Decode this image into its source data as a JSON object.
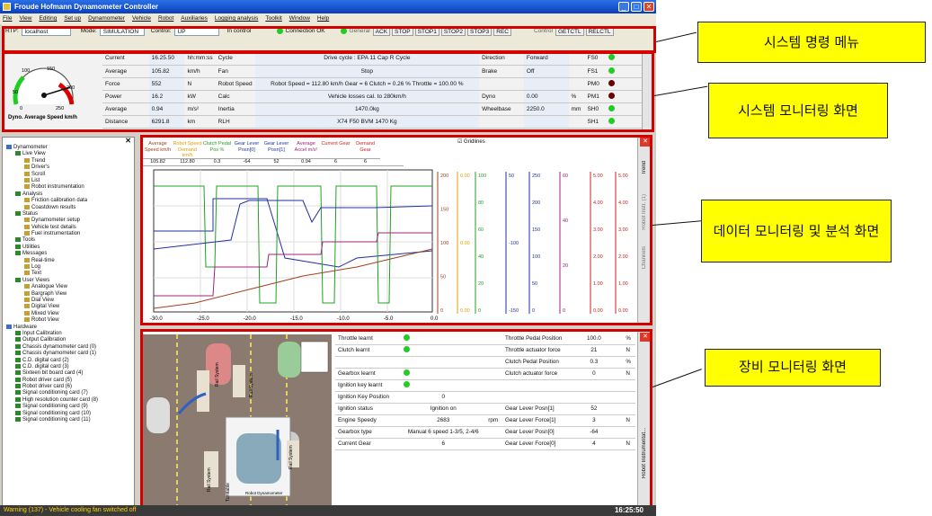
{
  "window": {
    "title": "Froude Hofmann Dynamometer Controller"
  },
  "menu": [
    "File",
    "View",
    "Editing",
    "Set up",
    "Dynamometer",
    "Vehicle",
    "Robot",
    "Auxiliaries",
    "Logging analysis",
    "Toolkit",
    "Window",
    "Help"
  ],
  "command_bar": {
    "rtp_label": "RTP:",
    "rtp_value": "localhost",
    "mode_label": "Mode:",
    "mode_value": "SIMULATION",
    "control_label": "Control:",
    "control_value": "UP",
    "in_control": "In control",
    "connection": "Connection OK",
    "general_label": "General",
    "general_buttons": [
      "ACK",
      "STOP",
      "STOP1",
      "STOP2",
      "STOP3",
      "REC"
    ],
    "control2_label": "Control",
    "control_buttons": [
      "GETCTL",
      "RELCTL"
    ]
  },
  "monitor": {
    "gauge_label": "Dyno. Average Speed km/h",
    "gauge_ticks": [
      "50",
      "100",
      "150",
      "200",
      "250",
      "0"
    ],
    "rows": [
      {
        "name": "Current",
        "value": "16.25.50",
        "unit": "hh:mm:ss",
        "c2": "Cycle",
        "c2v": "Drive cycle : EPA 11 Cap R Cycle",
        "c3": "Direction",
        "c3v": "Forward",
        "c4": "FS0"
      },
      {
        "name": "Average",
        "value": "105.82",
        "unit": "km/h",
        "c2": "Fan",
        "c2v": "Stop",
        "c3": "Brake",
        "c3v": "Off",
        "c4": "FS1"
      },
      {
        "name": "Force",
        "value": "552",
        "unit": "N",
        "c2": "Robot Speed",
        "c2v": "Robot Speed = 112.80 km/h Gear = 6 Clutch = 0.26 % Throttle = 100.00 %",
        "c3": "",
        "c3v": "",
        "c4": "PM0"
      },
      {
        "name": "Power",
        "value": "16.2",
        "unit": "kW",
        "c2": "Calc",
        "c2v": "Vehicle losses cal. to 280km/h",
        "c3": "Dyno",
        "c3v": "0.00",
        "c3u": "%",
        "c4": "PM1"
      },
      {
        "name": "Average",
        "value": "0.94",
        "unit": "m/s²",
        "c2": "Inertia",
        "c2v": "1470.0kg",
        "c3": "Wheelbase",
        "c3v": "2250.0",
        "c3u": "mm",
        "c4": "SH0"
      },
      {
        "name": "Distance",
        "value": "6291.8",
        "unit": "km",
        "c2": "RLH",
        "c2v": "X74 F50 BVM 1470 Kg",
        "c3": "",
        "c3v": "",
        "c4": "SH1"
      }
    ]
  },
  "tree": [
    {
      "label": "Dynamometer",
      "level": 0
    },
    {
      "label": "Live View",
      "level": 1
    },
    {
      "label": "Trend",
      "level": 2
    },
    {
      "label": "Driver's",
      "level": 2
    },
    {
      "label": "Scroll",
      "level": 2
    },
    {
      "label": "List",
      "level": 2
    },
    {
      "label": "Robot instrumentation",
      "level": 2
    },
    {
      "label": "Analysis",
      "level": 1
    },
    {
      "label": "Friction calibration data",
      "level": 2
    },
    {
      "label": "Coastdown results",
      "level": 2
    },
    {
      "label": "Status",
      "level": 1
    },
    {
      "label": "Dynamometer setup",
      "level": 2
    },
    {
      "label": "Vehicle test details",
      "level": 2
    },
    {
      "label": "Fuel instrumentation",
      "level": 2
    },
    {
      "label": "Tools",
      "level": 1
    },
    {
      "label": "Utilities",
      "level": 1
    },
    {
      "label": "Messages",
      "level": 1
    },
    {
      "label": "Real-time",
      "level": 2
    },
    {
      "label": "Log",
      "level": 2
    },
    {
      "label": "Text",
      "level": 2
    },
    {
      "label": "User Views",
      "level": 1
    },
    {
      "label": "Analogue View",
      "level": 2
    },
    {
      "label": "Bargraph View",
      "level": 2
    },
    {
      "label": "Dial View",
      "level": 2
    },
    {
      "label": "Digital View",
      "level": 2
    },
    {
      "label": "Mixed View",
      "level": 2
    },
    {
      "label": "Robot View",
      "level": 2
    },
    {
      "label": "Hardware",
      "level": 0
    },
    {
      "label": "Input Calibration",
      "level": 1
    },
    {
      "label": "Output Calibration",
      "level": 1
    },
    {
      "label": "Chassis dynamometer card (0)",
      "level": 1
    },
    {
      "label": "Chassis dynamometer card (1)",
      "level": 1
    },
    {
      "label": "C.D. digital card (2)",
      "level": 1
    },
    {
      "label": "C.D. digital card (3)",
      "level": 1
    },
    {
      "label": "Sixteen bit board card (4)",
      "level": 1
    },
    {
      "label": "Robot driver card (5)",
      "level": 1
    },
    {
      "label": "Robot driver card (6)",
      "level": 1
    },
    {
      "label": "Signal conditioning card (7)",
      "level": 1
    },
    {
      "label": "High resolution counter card (8)",
      "level": 1
    },
    {
      "label": "Signal conditioning card (9)",
      "level": 1
    },
    {
      "label": "Signal conditioning card (10)",
      "level": 1
    },
    {
      "label": "Signal conditioning card (11)",
      "level": 1
    }
  ],
  "graph": {
    "gridlines_label": "Gridlines",
    "legend": [
      {
        "name": "Average Speed km/h",
        "value": "105.82",
        "color": "#a04020"
      },
      {
        "name": "Robot Speed Demand km/h",
        "value": "112.80",
        "color": "#e0a000"
      },
      {
        "name": "Clutch Pedal Pos %",
        "value": "0.3",
        "color": "#20a020"
      },
      {
        "name": "Gear Lever Posn[0]",
        "value": "-64",
        "color": "#2030a0"
      },
      {
        "name": "Gear Lever Posn[1]",
        "value": "52",
        "color": "#2030a0"
      },
      {
        "name": "Average Accel m/s²",
        "value": "0.94",
        "color": "#a02080"
      },
      {
        "name": "Current Gear",
        "value": "6",
        "color": "#d02020"
      },
      {
        "name": "Demand Gear",
        "value": "6",
        "color": "#d02020"
      }
    ],
    "x_ticks": [
      "-30.0",
      "-25.0",
      "-20.0",
      "-15.0",
      "-10.0",
      "-5.0",
      "0.0"
    ],
    "axis1": [
      "200",
      "150",
      "100",
      "50",
      "0"
    ],
    "axis2": [
      "0.00",
      "0.00",
      "0.00"
    ],
    "axis3": [
      "100",
      "80",
      "60",
      "40",
      "20",
      "0"
    ],
    "axis4": [
      "50",
      "-100",
      "-150"
    ],
    "axis5": [
      "250",
      "200",
      "150",
      "100",
      "50",
      "0"
    ],
    "axis6": [
      "60",
      "40",
      "20",
      "0"
    ],
    "axis7": [
      "5.00",
      "4.00",
      "3.00",
      "2.00",
      "1.00",
      "0.00"
    ],
    "axis8": [
      "5.00",
      "4.00",
      "3.00",
      "2.00",
      "1.00",
      "0.00"
    ],
    "side_tabs": [
      "Trend",
      "Robot Instr. (1)",
      "Channels"
    ]
  },
  "device": {
    "left_rows": [
      {
        "label": "Throttle learnt",
        "value": "",
        "unit": "",
        "led": true
      },
      {
        "label": "Clutch learnt",
        "value": "",
        "unit": "",
        "led": true
      },
      {
        "label": "",
        "value": "",
        "unit": "",
        "led": false
      },
      {
        "label": "Gearbox learnt",
        "value": "",
        "unit": "",
        "led": true
      },
      {
        "label": "Ignition key learnt",
        "value": "",
        "unit": "",
        "led": true
      },
      {
        "label": "Ignition Key Position",
        "value": "0",
        "unit": "",
        "led": false
      },
      {
        "label": "Ignition status",
        "value": "Ignition on",
        "unit": "",
        "led": false
      },
      {
        "label": "Engine Speedy",
        "value": "2683",
        "unit": "rpm",
        "led": false
      },
      {
        "label": "Gearbox type",
        "value": "Manual 6 speed 1-3/5, 2-4/6",
        "unit": "",
        "led": false
      },
      {
        "label": "Current Gear",
        "value": "6",
        "unit": "",
        "led": false
      }
    ],
    "right_rows": [
      {
        "label": "Throttle Pedal Position",
        "value": "100.0",
        "unit": "%"
      },
      {
        "label": "Throttle actuator force",
        "value": "21",
        "unit": "N"
      },
      {
        "label": "Clutch Pedal Position",
        "value": "0.3",
        "unit": "%"
      },
      {
        "label": "Clutch actuator force",
        "value": "0",
        "unit": "N"
      },
      {
        "label": "",
        "value": "",
        "unit": ""
      },
      {
        "label": "",
        "value": "",
        "unit": ""
      },
      {
        "label": "Gear Lever Posn[1]",
        "value": "52",
        "unit": ""
      },
      {
        "label": "Gear Lever Force[1]",
        "value": "3",
        "unit": "N"
      },
      {
        "label": "Gear Lever Posn[0]",
        "value": "-64",
        "unit": ""
      },
      {
        "label": "Gear Lever Force[0]",
        "value": "4",
        "unit": "N"
      }
    ],
    "diagram_labels": [
      "Rail System",
      "Rail System",
      "Rail System",
      "Rail System",
      "Turntable",
      "Robot Dynamometer"
    ],
    "side_tab": "Robot Instrumentat..."
  },
  "status": {
    "warning": "Warning (137) - Vehicle cooling fan switched off",
    "time": "16:25:50"
  },
  "callouts": [
    "시스템 명령 메뉴",
    "시스템 모니터링 화면",
    "데이터 모니터링 및 분석 화면",
    "장비 모니터링 화면"
  ],
  "colors": {
    "highlight_frame": "#d40000",
    "callout_bg": "#ffff00",
    "led_green": "#22cc22",
    "led_dark_red": "#6a0000"
  }
}
